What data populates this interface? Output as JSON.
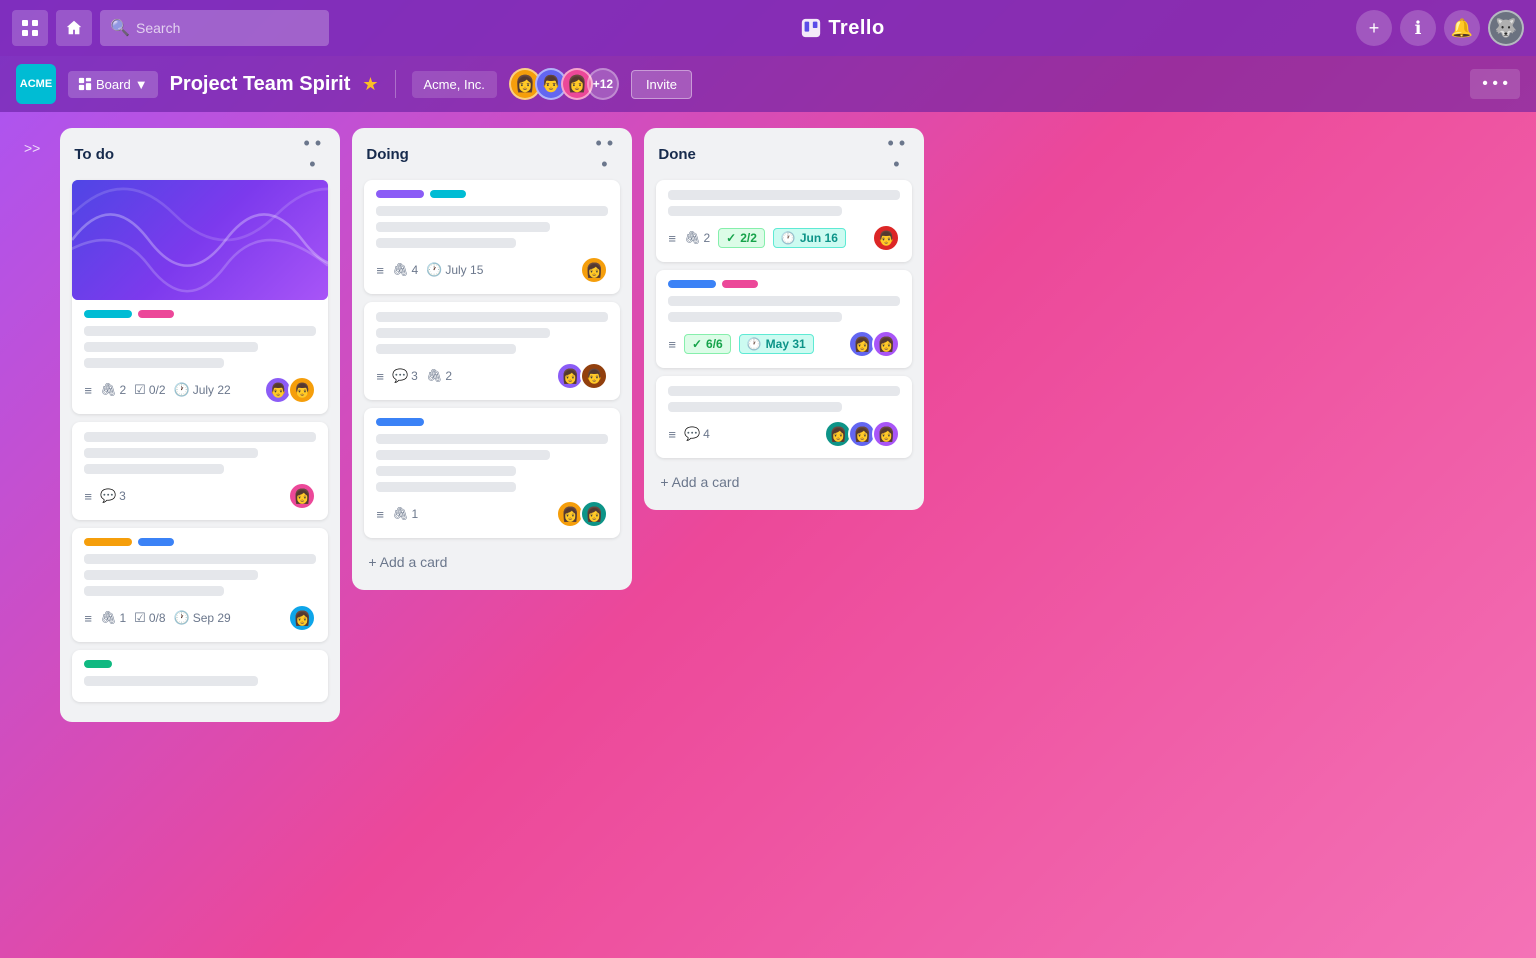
{
  "app": {
    "name": "Trello",
    "title": "Project Team Spirit"
  },
  "topnav": {
    "search_placeholder": "Search",
    "add_icon": "+",
    "info_icon": "ℹ",
    "bell_icon": "🔔"
  },
  "board_header": {
    "workspace_abbr": "ACME",
    "view_label": "Board",
    "title": "Project Team Spirit",
    "workspace_name": "Acme, Inc.",
    "avatar_count": "+12",
    "invite_label": "Invite"
  },
  "sidebar": {
    "collapse_label": ">>"
  },
  "lists": [
    {
      "id": "todo",
      "title": "To do",
      "cards": [
        {
          "id": "todo-1",
          "has_cover": true,
          "labels": [
            {
              "color": "cyan",
              "width": "wide"
            },
            {
              "color": "pink",
              "width": "med"
            }
          ],
          "lines": [
            "full",
            "med",
            "short"
          ],
          "meta": {
            "has_desc": true,
            "attachments": "2",
            "checklist": "0/2",
            "due": "July 22"
          },
          "avatars": [
            "person1",
            "person2"
          ]
        },
        {
          "id": "todo-2",
          "has_cover": false,
          "labels": [],
          "lines": [
            "full",
            "med",
            "short"
          ],
          "meta": {
            "has_desc": true,
            "comments": "3"
          },
          "avatars": [
            "person3"
          ]
        },
        {
          "id": "todo-3",
          "has_cover": false,
          "labels": [
            {
              "color": "yellow",
              "width": "wide"
            },
            {
              "color": "blue",
              "width": "med"
            }
          ],
          "lines": [
            "full",
            "med",
            "short"
          ],
          "meta": {
            "has_desc": true,
            "attachments": "1",
            "checklist": "0/8",
            "due": "Sep 29"
          },
          "avatars": [
            "person4"
          ]
        },
        {
          "id": "todo-4",
          "has_cover": false,
          "labels": [
            {
              "color": "green",
              "width": "sm"
            }
          ],
          "lines": [
            "med"
          ],
          "meta": {},
          "avatars": []
        }
      ]
    },
    {
      "id": "doing",
      "title": "Doing",
      "cards": [
        {
          "id": "doing-1",
          "has_cover": false,
          "labels": [
            {
              "color": "purple",
              "width": "wide"
            },
            {
              "color": "cyan",
              "width": "med"
            }
          ],
          "lines": [
            "full",
            "med",
            "short"
          ],
          "meta": {
            "has_desc": true,
            "attachments": "4",
            "due": "July 15"
          },
          "avatars": [
            "person5"
          ]
        },
        {
          "id": "doing-2",
          "has_cover": false,
          "labels": [],
          "lines": [
            "full",
            "med",
            "short"
          ],
          "meta": {
            "has_desc": true,
            "comments": "3",
            "attachments": "2"
          },
          "avatars": [
            "person6",
            "person7"
          ]
        },
        {
          "id": "doing-3",
          "has_cover": false,
          "labels": [
            {
              "color": "blue",
              "width": "wide"
            }
          ],
          "lines": [
            "full",
            "med",
            "short",
            "short"
          ],
          "meta": {
            "has_desc": true,
            "attachments": "1"
          },
          "avatars": [
            "person8",
            "person9"
          ]
        }
      ]
    },
    {
      "id": "done",
      "title": "Done",
      "cards": [
        {
          "id": "done-1",
          "has_cover": false,
          "labels": [],
          "lines": [
            "full",
            "med"
          ],
          "meta": {
            "has_desc": true,
            "attachments": "2",
            "checklist_badge": "2/2",
            "due_badge": "Jun 16"
          },
          "avatars": [
            "person10"
          ]
        },
        {
          "id": "done-2",
          "has_cover": false,
          "labels": [
            {
              "color": "blue",
              "width": "wide"
            },
            {
              "color": "pink",
              "width": "med"
            }
          ],
          "lines": [
            "full",
            "med"
          ],
          "meta": {
            "has_desc": true,
            "checklist_badge": "6/6",
            "due_badge": "May 31"
          },
          "avatars": [
            "person11",
            "person12"
          ]
        },
        {
          "id": "done-3",
          "has_cover": false,
          "labels": [],
          "lines": [
            "full",
            "med"
          ],
          "meta": {
            "has_desc": true,
            "comments": "4"
          },
          "avatars": [
            "person13",
            "person14",
            "person15"
          ]
        }
      ]
    }
  ],
  "add_card_label": "+ Add a card"
}
